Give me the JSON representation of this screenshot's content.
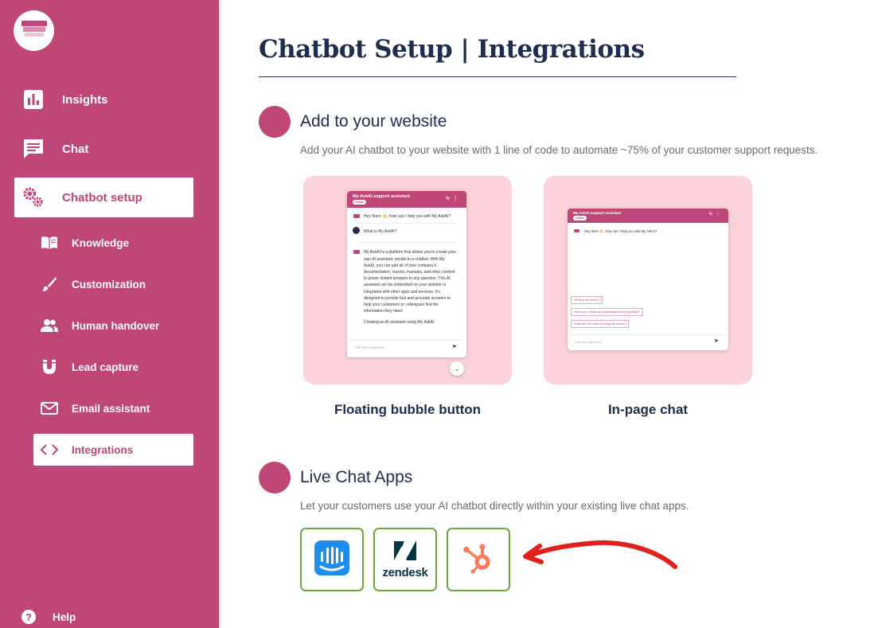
{
  "sidebar": {
    "items": [
      {
        "label": "Insights",
        "icon": "bar-chart-icon"
      },
      {
        "label": "Chat",
        "icon": "chat-icon"
      },
      {
        "label": "Chatbot setup",
        "icon": "gears-icon",
        "active": true
      }
    ],
    "subitems": [
      {
        "label": "Knowledge",
        "icon": "book-icon"
      },
      {
        "label": "Customization",
        "icon": "brush-icon"
      },
      {
        "label": "Human handover",
        "icon": "people-icon"
      },
      {
        "label": "Lead capture",
        "icon": "magnet-icon"
      },
      {
        "label": "Email assistant",
        "icon": "envelope-icon"
      },
      {
        "label": "Integrations",
        "icon": "code-icon",
        "active": true
      }
    ],
    "help_label": "Help",
    "help_icon": "?"
  },
  "main": {
    "title": "Chatbot Setup | Integrations",
    "website_section": {
      "title": "Add to your website",
      "description": "Add your AI chatbot to your website with 1 line of code to automate ~75% of your customer support requests.",
      "options": [
        {
          "label": "Floating bubble button"
        },
        {
          "label": "In-page chat"
        }
      ]
    },
    "livechat_section": {
      "title": "Live Chat Apps",
      "description": "Let your customers use your AI chatbot directly within your existing live chat apps.",
      "apps": [
        {
          "name": "intercom-icon"
        },
        {
          "name": "zendesk-icon",
          "word": "zendesk"
        },
        {
          "name": "hubspot-icon"
        }
      ]
    }
  },
  "mock_chat": {
    "header_title": "My AskAI support assistant",
    "status_pill": "Online",
    "greeting": "Hey there 👋, how can I help you with My AskAI?",
    "question": "What is My AskAI?",
    "answer": "My AskAI is a platform that allows you to create your own AI assistant, similar to a chatbot. With My AskAI, you can add all of your company's documentation, reports, manuals, and other content to power instant answers to any question. This AI assistant can be embedded on your website or integrated with other apps and services. It's designed to provide fast and accurate answers to help your customers or colleagues find the information they need.",
    "answer_cont": "Creating an AI assistant using My AskAI",
    "input_placeholder": "Ask me a question",
    "suggestions": [
      "What is My AskAI?",
      "How can I create an AI assistant using My AskAI?",
      "What are the costs of using My AskAI?"
    ]
  },
  "colors": {
    "brand_pink": "#bf4676",
    "navy": "#1f2d4e",
    "card_pink": "#fcd3da",
    "tile_border": "#6ea640",
    "annotation_red": "#e0201b"
  }
}
